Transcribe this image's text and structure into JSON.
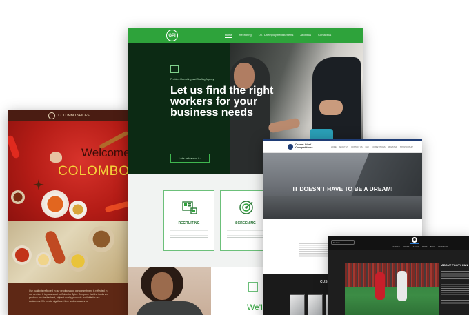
{
  "colombo": {
    "brand": "COLOMBO SPICES",
    "welcome": "Welcome",
    "name": "COLOMBO",
    "body_text": "Our quality is reflected in our products and our commitment is reflected in our service. It is paramount to Colombo Spice Company that the foods we produce are the freshest, highest quality products available for our customers. We create significant time and resources to"
  },
  "gpi": {
    "logo": "GPI",
    "menu": [
      "Home",
      "Recruiting",
      "Oil / Unemployment Benefits",
      "About us",
      "Contact us"
    ],
    "tagline": "Problem Recruiting and Staffing Agency",
    "headline": "Let us find the right workers for your business needs",
    "cta": "Let's talk about it  ›",
    "services": [
      {
        "label": "RECRUITING",
        "icon": "recruiting-icon"
      },
      {
        "label": "SCREENING",
        "icon": "screening-icon"
      }
    ],
    "bottom_heading": "We'l",
    "accent": "#2ea33b",
    "hero_bg": "#0c2a14"
  },
  "dream": {
    "brand_line1": "Dream Steel",
    "brand_line2": "Competitions",
    "menu": [
      "HOME",
      "ABOUT US",
      "CONTACT US",
      "FAQ",
      "COMPETITIONS",
      "REGISTER",
      "SPONSORSHIP"
    ],
    "headline": "IT DOESN'T HAVE TO BE A DREAM!",
    "welcome": "WELCOME T",
    "customers_heading": "CUS"
  },
  "footy": {
    "search_placeholder": "Search",
    "logo": "FOOTY FANS",
    "menu": [
      "GENERAL",
      "SPORT",
      "LEAGUE",
      "NEWS",
      "BLOG",
      "CALENDAR"
    ],
    "about_heading": "ABOUT FOOTY FAN"
  }
}
